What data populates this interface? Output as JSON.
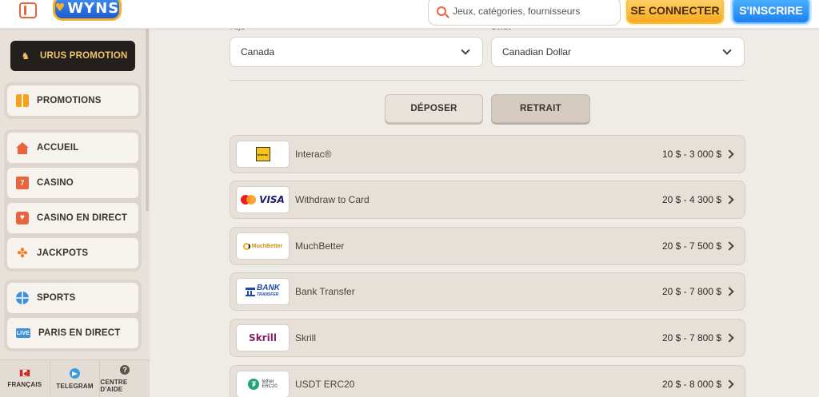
{
  "header": {
    "brand": "WYNS",
    "search": {
      "placeholder": "Jeux, catégories, fournisseurs"
    },
    "login_label": "SE CONNECTER",
    "signup_label": "S'INSCRIRE"
  },
  "sidebar": {
    "promo_label": "URUS PROMOTION",
    "promotions_label": "PROMOTIONS",
    "casino_group": [
      {
        "label": "ACCUEIL",
        "icon": "home-icon"
      },
      {
        "label": "CASINO",
        "icon": "slot-machine-icon"
      },
      {
        "label": "CASINO EN DIRECT",
        "icon": "live-casino-icon"
      },
      {
        "label": "JACKPOTS",
        "icon": "clover-icon"
      }
    ],
    "sports_group": [
      {
        "label": "SPORTS",
        "icon": "basketball-icon"
      },
      {
        "label": "PARIS EN DIRECT",
        "icon": "live-badge-icon"
      }
    ],
    "footer": {
      "language": "FRANÇAIS",
      "telegram": "TELEGRAM",
      "help": "CENTRE D'AIDE"
    }
  },
  "main": {
    "country_label": "Pays",
    "country_value": "Canada",
    "currency_label": "Devise",
    "currency_value": "Canadian Dollar",
    "tab_deposit": "DÉPOSER",
    "tab_withdraw": "RETRAIT",
    "methods": [
      {
        "name": "Interac®",
        "range": "10 $ - 3 000 $",
        "logo_text": "Interac"
      },
      {
        "name": "Withdraw to Card",
        "range": "20 $ - 4 300 $",
        "logo_text": "VISA"
      },
      {
        "name": "MuchBetter",
        "range": "20 $ - 7 500 $",
        "logo_text": "MuchBetter"
      },
      {
        "name": "Bank Transfer",
        "range": "20 $ - 7 800 $",
        "logo_text": "BANK",
        "logo_sub": "TRANSFER"
      },
      {
        "name": "Skrill",
        "range": "20 $ - 7 800 $",
        "logo_text": "Skrill"
      },
      {
        "name": "USDT ERC20",
        "range": "20 $ - 8 000 $",
        "logo_text": "tether",
        "logo_sub": "ERC20"
      }
    ]
  },
  "colors": {
    "accent_orange": "#e8643c",
    "login_gold": "#f7a91f",
    "signup_blue": "#1f7ff0",
    "page_bg": "#efebe6"
  }
}
